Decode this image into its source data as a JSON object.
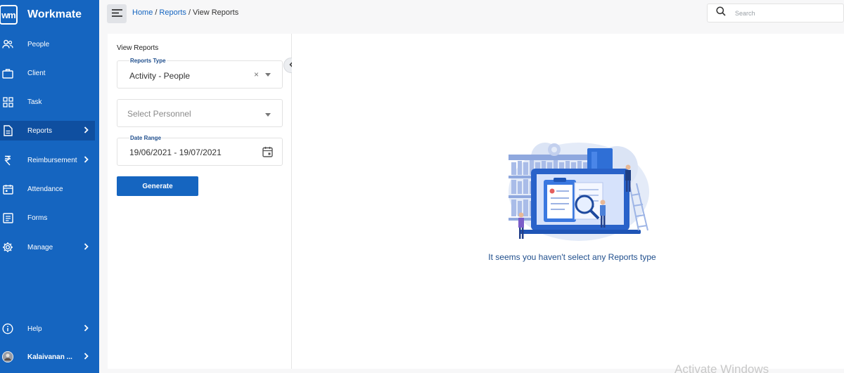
{
  "app": {
    "logo_text": "wm",
    "name": "Workmate"
  },
  "sidebar": {
    "items": [
      {
        "label": "People",
        "icon": "people-icon",
        "has_submenu": false
      },
      {
        "label": "Client",
        "icon": "briefcase-icon",
        "has_submenu": false
      },
      {
        "label": "Task",
        "icon": "task-grid-icon",
        "has_submenu": false
      },
      {
        "label": "Reports",
        "icon": "document-icon",
        "has_submenu": true,
        "active": true
      },
      {
        "label": "Reimbursement",
        "icon": "rupee-icon",
        "has_submenu": true
      },
      {
        "label": "Attendance",
        "icon": "calendar-icon",
        "has_submenu": false
      },
      {
        "label": "Forms",
        "icon": "form-icon",
        "has_submenu": false
      },
      {
        "label": "Manage",
        "icon": "gear-icon",
        "has_submenu": true
      }
    ],
    "help": {
      "label": "Help",
      "icon": "info-icon"
    },
    "user": {
      "label": "Kalaivanan ...",
      "icon": "avatar"
    }
  },
  "header": {
    "breadcrumb": {
      "home": "Home",
      "sep1": "/",
      "reports": "Reports",
      "sep2": "/",
      "current": "View Reports"
    },
    "search": {
      "placeholder": "Search"
    }
  },
  "reports_panel": {
    "title": "View Reports",
    "reports_type": {
      "label": "Reports Type",
      "value": "Activity - People",
      "clear": "×"
    },
    "personnel": {
      "placeholder": "Select Personnel"
    },
    "date_range": {
      "label": "Date Range",
      "value": "19/06/2021 - 19/07/2021"
    },
    "generate_label": "Generate"
  },
  "empty_state": {
    "message": "It seems you haven't select any Reports type"
  },
  "watermark": "Activate Windows",
  "colors": {
    "primary": "#1565c0",
    "sidebar_active": "#0f4fa0",
    "label_blue": "#1f4e8c"
  }
}
